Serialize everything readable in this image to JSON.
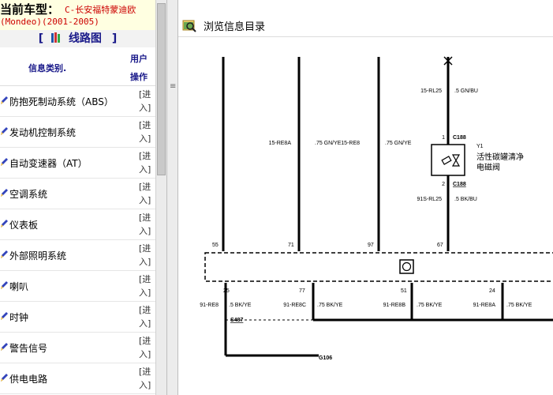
{
  "vehicle": {
    "label": "当前车型：",
    "model": "C-长安福特蒙迪欧",
    "years": "(Mondeo)(2001-2005)"
  },
  "sidebar": {
    "title_left": "[",
    "title": "线路图",
    "title_right": "]",
    "col_info": "信息类别.",
    "col_user": "用户",
    "col_op": "操作",
    "enter_label": "[进入]",
    "items": [
      {
        "label": "防抱死制动系统（ABS）"
      },
      {
        "label": "发动机控制系统"
      },
      {
        "label": "自动变速器（AT）"
      },
      {
        "label": "空调系统"
      },
      {
        "label": "仪表板"
      },
      {
        "label": "外部照明系统"
      },
      {
        "label": "喇叭"
      },
      {
        "label": "时钟"
      },
      {
        "label": "警告信号"
      },
      {
        "label": "供电电路"
      }
    ]
  },
  "browse": {
    "title": "浏览信息目录"
  },
  "diagram": {
    "wire_top_left": {
      "circuit": "15-RE8A",
      "color": ".75 GN/YE"
    },
    "wire_top_mid": {
      "circuit": "15-RE8",
      "color": ".75 GN/YE"
    },
    "wire_top_right": {
      "circuit": "15-RL25",
      "color": ".5 GN/BU"
    },
    "connector_top": "C188",
    "connector_bottom": "C188",
    "pin_top": "1",
    "pin_bottom": "2",
    "component_id": "Y1",
    "component_name_line1": "活性碳罐清净",
    "component_name_line2": "电磁阀",
    "wire_below_valve": {
      "circuit": "91S-RL25",
      "color": ".5 BK/BU"
    },
    "pins_top": [
      "55",
      "71",
      "97",
      "67"
    ],
    "pins_bottom": [
      "25",
      "77",
      "51",
      "24"
    ],
    "bottom_wires": [
      {
        "circuit": "91-RE8",
        "color": ".5 BK/YE"
      },
      {
        "circuit": "91-RE8C",
        "color": ".75 BK/YE"
      },
      {
        "circuit": "91-RE8B",
        "color": ".75 BK/YE"
      },
      {
        "circuit": "91-RE8A",
        "color": ".75 BK/YE"
      }
    ],
    "splice": "S487",
    "ground": "G106"
  }
}
